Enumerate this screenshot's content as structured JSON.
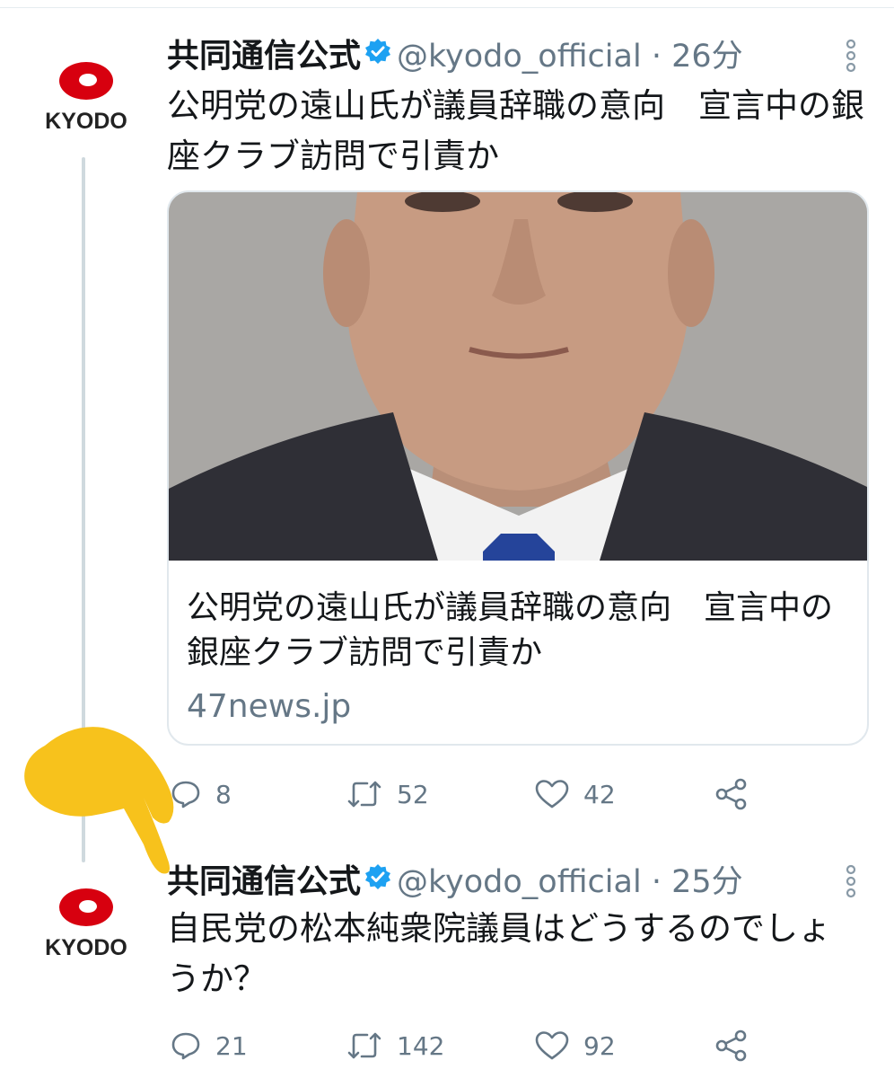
{
  "tweets": [
    {
      "author": "共同通信公式",
      "handle": "@kyodo_official",
      "time": " · 26分",
      "avatar_text": "KYODO",
      "text": "公明党の遠山氏が議員辞職の意向　宣言中の銀座クラブ訪問で引責か",
      "card": {
        "title": "公明党の遠山氏が議員辞職の意向　宣言中の銀座クラブ訪問で引責か",
        "domain": "47news.jp"
      },
      "replies": "8",
      "retweets": "52",
      "likes": "42"
    },
    {
      "author": "共同通信公式",
      "handle": "@kyodo_official",
      "time": " · 25分",
      "avatar_text": "KYODO",
      "text": "自民党の松本純衆院議員はどうするのでしょうか？",
      "replies": "21",
      "retweets": "142",
      "likes": "92"
    }
  ],
  "colors": {
    "brand_red": "#d7000f",
    "verified_blue": "#1da1f2",
    "muted_text": "#657786",
    "hand_yellow": "#f7c21c"
  },
  "icons": [
    "verified-icon",
    "more-icon",
    "reply-icon",
    "retweet-icon",
    "like-icon",
    "share-icon",
    "pointing-hand-icon"
  ]
}
